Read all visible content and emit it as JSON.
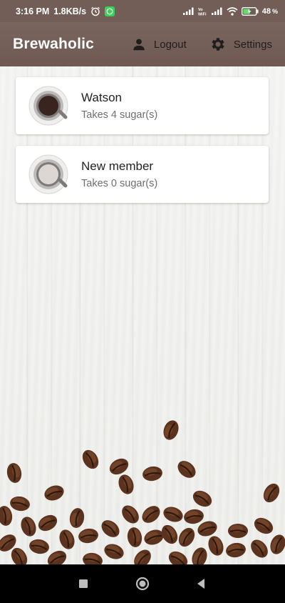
{
  "status_bar": {
    "time": "3:16 PM",
    "net_speed": "1.8KB/s",
    "battery": "48"
  },
  "app_bar": {
    "title": "Brewaholic",
    "logout_label": "Logout",
    "settings_label": "Settings",
    "color": "#725e57"
  },
  "members": [
    {
      "name": "Watson",
      "sugar_text": "Takes 4 sugar(s)",
      "cup_fill": "#3a2420"
    },
    {
      "name": "New member",
      "sugar_text": "Takes 0 sugar(s)",
      "cup_fill": "#ddd7d4"
    }
  ],
  "icons": {
    "logout": "person-icon",
    "settings": "gear-icon",
    "nav_recent": "square-icon",
    "nav_home": "circle-icon",
    "nav_back": "triangle-back-icon"
  }
}
